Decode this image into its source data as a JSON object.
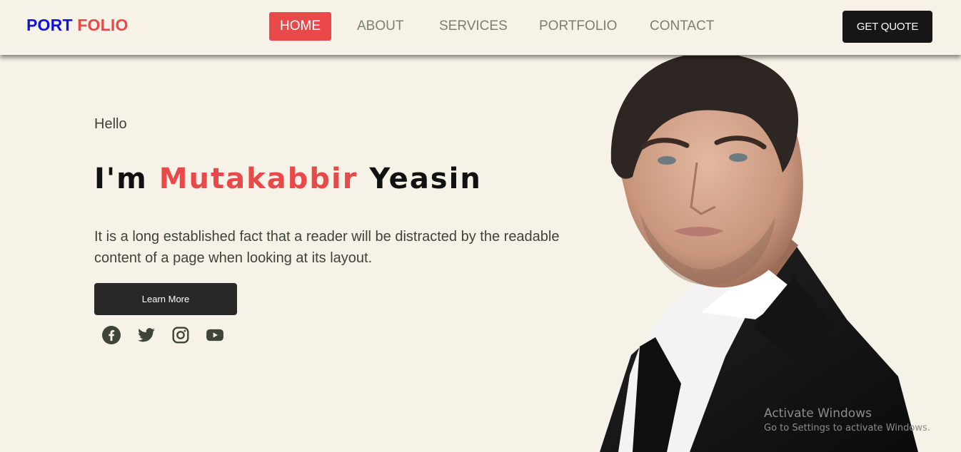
{
  "logo": {
    "part1": "PORT",
    "part2": "FOLIO"
  },
  "nav": {
    "items": [
      {
        "label": "HOME"
      },
      {
        "label": "ABOUT"
      },
      {
        "label": "SERVICES"
      },
      {
        "label": "PORTFOLIO"
      },
      {
        "label": "CONTACT"
      }
    ],
    "cta_label": "GET QUOTE"
  },
  "hero": {
    "greeting": "Hello",
    "name_prefix": "I'm",
    "name_first": "Mutakabbir",
    "name_last": "Yeasin",
    "description": "It is a long established fact that a reader will be distracted by the readable content of a page when looking at its layout.",
    "button_label": "Learn More",
    "socials": [
      "facebook-icon",
      "twitter-icon",
      "instagram-icon",
      "youtube-icon"
    ],
    "portrait": "man-in-black-suit-photo"
  },
  "watermark": {
    "title": "Activate Windows",
    "subtitle": "Go to Settings to activate Windows."
  },
  "colors": {
    "background": "#f7f2e7",
    "accent": "#e94949",
    "logo_blue": "#1111dd",
    "dark_button": "#161616",
    "text": "#3e4238",
    "nav_text": "#7a7f72"
  }
}
